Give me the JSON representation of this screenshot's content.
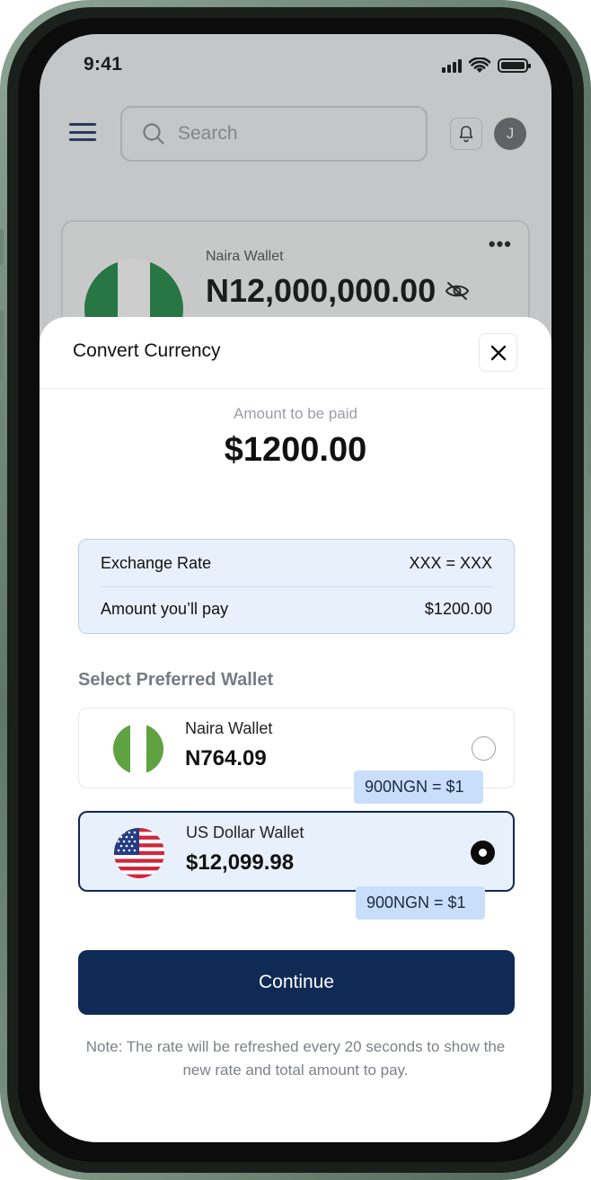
{
  "status_bar": {
    "time": "9:41"
  },
  "header": {
    "search_placeholder": "Search",
    "avatar_initial": "J"
  },
  "background_wallet": {
    "title": "Naira Wallet",
    "amount": "N12,000,000.00"
  },
  "sheet": {
    "title": "Convert Currency",
    "amount_label": "Amount to be paid",
    "amount_value": "$1200.00",
    "exchange_rate_label": "Exchange Rate",
    "exchange_rate_value": "XXX = XXX",
    "amount_pay_label": "Amount you’ll pay",
    "amount_pay_value": "$1200.00",
    "select_label": "Select Preferred Wallet",
    "wallets": [
      {
        "name": "Naira Wallet",
        "balance": "N764.09",
        "rate": "900NGN = $1",
        "selected": false
      },
      {
        "name": "US Dollar Wallet",
        "balance": "$12,099.98",
        "rate": "900NGN = $1",
        "selected": true
      }
    ],
    "continue_label": "Continue",
    "note": "Note: The rate will be refreshed every 20 seconds to show the new rate and total amount to pay."
  },
  "colors": {
    "primary": "#0f2a55",
    "rate_box_bg": "#e8f0fc",
    "rate_tag_bg": "#c9defb",
    "nigeria_green": "#1f8a47",
    "us_red": "#d2263a",
    "us_blue": "#243c84"
  },
  "icons": [
    "menu-icon",
    "search-icon",
    "bell-icon",
    "more-icon",
    "eye-off-icon",
    "close-icon",
    "signal-icon",
    "wifi-icon",
    "battery-icon"
  ]
}
